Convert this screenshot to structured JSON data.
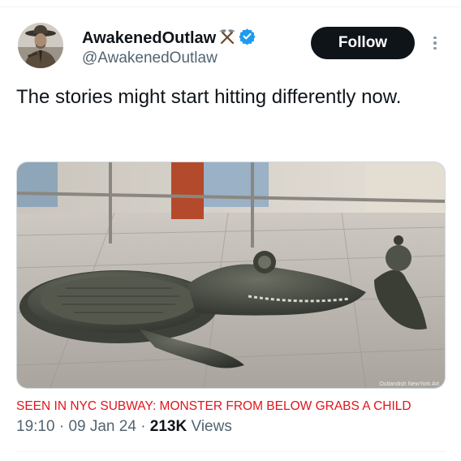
{
  "tweet": {
    "author": {
      "display_name": "AwakenedOutlaw",
      "name_emoji_icon": "crossed-pickaxes-icon",
      "verified_icon": "verified-badge-icon",
      "verified_color": "#1d9bf0",
      "handle": "@AwakenedOutlaw",
      "avatar_icon": "cowboy-avatar"
    },
    "follow_label": "Follow",
    "more_icon": "more-vertical-icon",
    "text": "The stories might start hitting differently now.",
    "media": {
      "watermark": "Outlandish NewYork Art"
    },
    "caption": "SEEN IN NYC SUBWAY: MONSTER FROM BELOW GRABS A CHILD",
    "time": "19:10",
    "sep1": "·",
    "date": "09 Jan 24",
    "sep2": "·",
    "views_count": "213K",
    "views_label": "Views"
  },
  "colors": {
    "follow_bg": "#0f1419",
    "caption_red": "#e0151b",
    "muted": "#536471"
  }
}
